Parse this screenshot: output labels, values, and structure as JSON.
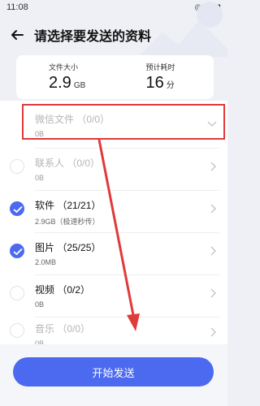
{
  "status_bar": {
    "time": "11:08",
    "icons_right": "◎ ▾◢ ▮"
  },
  "header": {
    "title": "请选择要发送的资料",
    "back_icon": "back-arrow-icon"
  },
  "summary": {
    "size_label": "文件大小",
    "size_value": "2.9",
    "size_unit": "GB",
    "time_label": "预计耗时",
    "time_value": "16",
    "time_unit": "分"
  },
  "items": [
    {
      "title": "微信文件 （0/0）",
      "sub": "0B",
      "checked": false,
      "disabled": true,
      "chevron": "chevron-down-icon"
    },
    {
      "title": "联系人 （0/0）",
      "sub": "0B",
      "checked": false,
      "disabled": true,
      "chevron": "chevron-right-icon"
    },
    {
      "title": "软件 （21/21）",
      "sub": "2.9GB（极速秒传）",
      "checked": true,
      "disabled": false,
      "chevron": "chevron-right-icon"
    },
    {
      "title": "图片 （25/25）",
      "sub": "2.0MB",
      "checked": true,
      "disabled": false,
      "chevron": "chevron-right-icon"
    },
    {
      "title": "视频 （0/2）",
      "sub": "0B",
      "checked": false,
      "disabled": false,
      "chevron": "chevron-right-icon"
    },
    {
      "title": "音乐 （0/0）",
      "sub": "0B",
      "checked": false,
      "disabled": true,
      "chevron": "chevron-right-icon"
    }
  ],
  "actions": {
    "start_label": "开始发送"
  },
  "colors": {
    "accent": "#4b6af0",
    "annotation": "#e03a3a"
  }
}
